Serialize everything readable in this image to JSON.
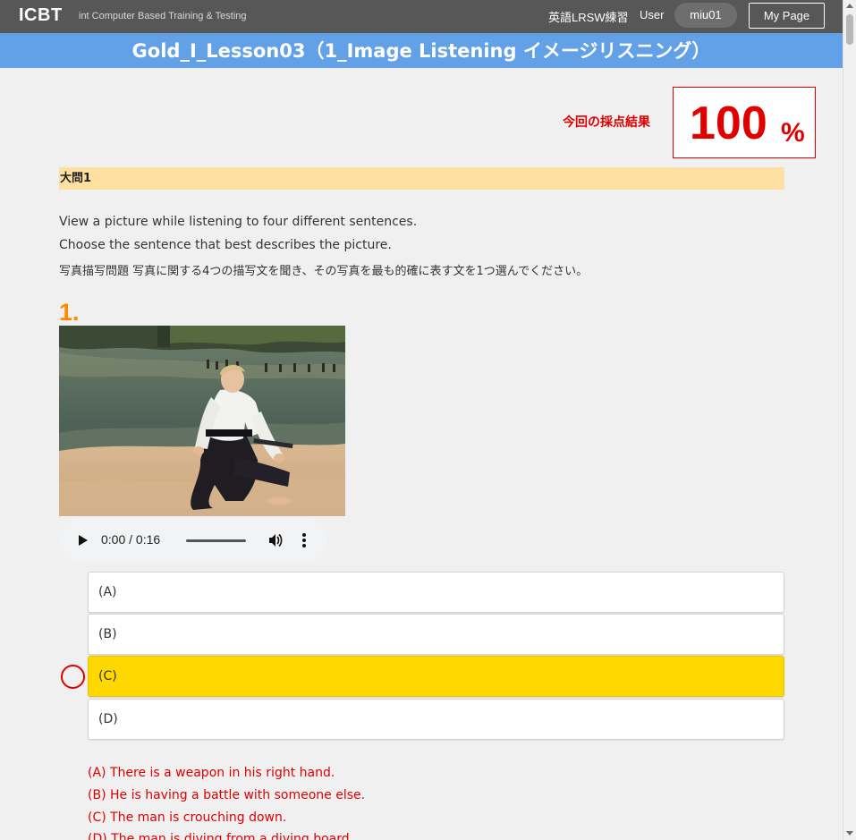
{
  "header": {
    "logo": "ICBT",
    "tagline": "int Computer Based Training & Testing",
    "course": "英語LRSW練習",
    "user_label": "User",
    "username": "miu01",
    "mypage_label": "My Page"
  },
  "title": "Gold_I_Lesson03（1_Image Listening イメージリスニング）",
  "score": {
    "label": "今回の採点結果",
    "value": "100",
    "unit": "%"
  },
  "section": {
    "title": "大問1",
    "instructions": [
      "View a picture while listening to four different sentences.",
      "Choose the sentence that best describes the picture.",
      "写真描写問題 写真に関する4つの描写文を聞き、その写真を最も的確に表す文を1つ選んでください。"
    ]
  },
  "question": {
    "number": "1.",
    "audio": {
      "time": "0:00 / 0:16"
    },
    "choices": [
      {
        "label": "(A)",
        "selected": false
      },
      {
        "label": "(B)",
        "selected": false
      },
      {
        "label": "(C)",
        "selected": true
      },
      {
        "label": "(D)",
        "selected": false
      }
    ],
    "answers": [
      "(A) There is a weapon in his right hand.",
      "(B) He is having a battle with someone else.",
      "(C) The man is crouching down.",
      "(D) The man is diving from a diving board."
    ]
  },
  "colors": {
    "header_bg": "#575757",
    "title_bg": "#62a0e7",
    "score_red": "#e00000",
    "section_bg": "#ffe0a3",
    "question_orange": "#ff8a00",
    "selected_yellow": "#ffd800"
  }
}
